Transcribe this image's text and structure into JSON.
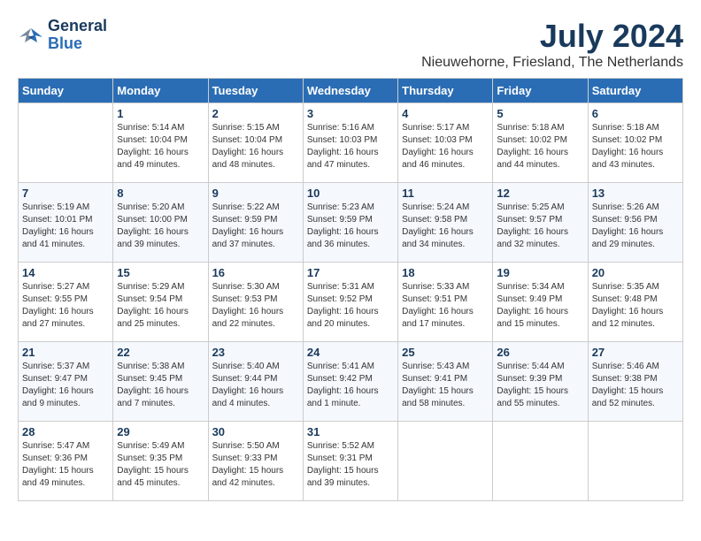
{
  "header": {
    "logo": {
      "line1": "General",
      "line2": "Blue"
    },
    "title": "July 2024",
    "location": "Nieuwehorne, Friesland, The Netherlands"
  },
  "calendar": {
    "days_of_week": [
      "Sunday",
      "Monday",
      "Tuesday",
      "Wednesday",
      "Thursday",
      "Friday",
      "Saturday"
    ],
    "weeks": [
      {
        "days": [
          {
            "num": "",
            "info": ""
          },
          {
            "num": "1",
            "info": "Sunrise: 5:14 AM\nSunset: 10:04 PM\nDaylight: 16 hours\nand 49 minutes."
          },
          {
            "num": "2",
            "info": "Sunrise: 5:15 AM\nSunset: 10:04 PM\nDaylight: 16 hours\nand 48 minutes."
          },
          {
            "num": "3",
            "info": "Sunrise: 5:16 AM\nSunset: 10:03 PM\nDaylight: 16 hours\nand 47 minutes."
          },
          {
            "num": "4",
            "info": "Sunrise: 5:17 AM\nSunset: 10:03 PM\nDaylight: 16 hours\nand 46 minutes."
          },
          {
            "num": "5",
            "info": "Sunrise: 5:18 AM\nSunset: 10:02 PM\nDaylight: 16 hours\nand 44 minutes."
          },
          {
            "num": "6",
            "info": "Sunrise: 5:18 AM\nSunset: 10:02 PM\nDaylight: 16 hours\nand 43 minutes."
          }
        ]
      },
      {
        "days": [
          {
            "num": "7",
            "info": "Sunrise: 5:19 AM\nSunset: 10:01 PM\nDaylight: 16 hours\nand 41 minutes."
          },
          {
            "num": "8",
            "info": "Sunrise: 5:20 AM\nSunset: 10:00 PM\nDaylight: 16 hours\nand 39 minutes."
          },
          {
            "num": "9",
            "info": "Sunrise: 5:22 AM\nSunset: 9:59 PM\nDaylight: 16 hours\nand 37 minutes."
          },
          {
            "num": "10",
            "info": "Sunrise: 5:23 AM\nSunset: 9:59 PM\nDaylight: 16 hours\nand 36 minutes."
          },
          {
            "num": "11",
            "info": "Sunrise: 5:24 AM\nSunset: 9:58 PM\nDaylight: 16 hours\nand 34 minutes."
          },
          {
            "num": "12",
            "info": "Sunrise: 5:25 AM\nSunset: 9:57 PM\nDaylight: 16 hours\nand 32 minutes."
          },
          {
            "num": "13",
            "info": "Sunrise: 5:26 AM\nSunset: 9:56 PM\nDaylight: 16 hours\nand 29 minutes."
          }
        ]
      },
      {
        "days": [
          {
            "num": "14",
            "info": "Sunrise: 5:27 AM\nSunset: 9:55 PM\nDaylight: 16 hours\nand 27 minutes."
          },
          {
            "num": "15",
            "info": "Sunrise: 5:29 AM\nSunset: 9:54 PM\nDaylight: 16 hours\nand 25 minutes."
          },
          {
            "num": "16",
            "info": "Sunrise: 5:30 AM\nSunset: 9:53 PM\nDaylight: 16 hours\nand 22 minutes."
          },
          {
            "num": "17",
            "info": "Sunrise: 5:31 AM\nSunset: 9:52 PM\nDaylight: 16 hours\nand 20 minutes."
          },
          {
            "num": "18",
            "info": "Sunrise: 5:33 AM\nSunset: 9:51 PM\nDaylight: 16 hours\nand 17 minutes."
          },
          {
            "num": "19",
            "info": "Sunrise: 5:34 AM\nSunset: 9:49 PM\nDaylight: 16 hours\nand 15 minutes."
          },
          {
            "num": "20",
            "info": "Sunrise: 5:35 AM\nSunset: 9:48 PM\nDaylight: 16 hours\nand 12 minutes."
          }
        ]
      },
      {
        "days": [
          {
            "num": "21",
            "info": "Sunrise: 5:37 AM\nSunset: 9:47 PM\nDaylight: 16 hours\nand 9 minutes."
          },
          {
            "num": "22",
            "info": "Sunrise: 5:38 AM\nSunset: 9:45 PM\nDaylight: 16 hours\nand 7 minutes."
          },
          {
            "num": "23",
            "info": "Sunrise: 5:40 AM\nSunset: 9:44 PM\nDaylight: 16 hours\nand 4 minutes."
          },
          {
            "num": "24",
            "info": "Sunrise: 5:41 AM\nSunset: 9:42 PM\nDaylight: 16 hours\nand 1 minute."
          },
          {
            "num": "25",
            "info": "Sunrise: 5:43 AM\nSunset: 9:41 PM\nDaylight: 15 hours\nand 58 minutes."
          },
          {
            "num": "26",
            "info": "Sunrise: 5:44 AM\nSunset: 9:39 PM\nDaylight: 15 hours\nand 55 minutes."
          },
          {
            "num": "27",
            "info": "Sunrise: 5:46 AM\nSunset: 9:38 PM\nDaylight: 15 hours\nand 52 minutes."
          }
        ]
      },
      {
        "days": [
          {
            "num": "28",
            "info": "Sunrise: 5:47 AM\nSunset: 9:36 PM\nDaylight: 15 hours\nand 49 minutes."
          },
          {
            "num": "29",
            "info": "Sunrise: 5:49 AM\nSunset: 9:35 PM\nDaylight: 15 hours\nand 45 minutes."
          },
          {
            "num": "30",
            "info": "Sunrise: 5:50 AM\nSunset: 9:33 PM\nDaylight: 15 hours\nand 42 minutes."
          },
          {
            "num": "31",
            "info": "Sunrise: 5:52 AM\nSunset: 9:31 PM\nDaylight: 15 hours\nand 39 minutes."
          },
          {
            "num": "",
            "info": ""
          },
          {
            "num": "",
            "info": ""
          },
          {
            "num": "",
            "info": ""
          }
        ]
      }
    ]
  }
}
